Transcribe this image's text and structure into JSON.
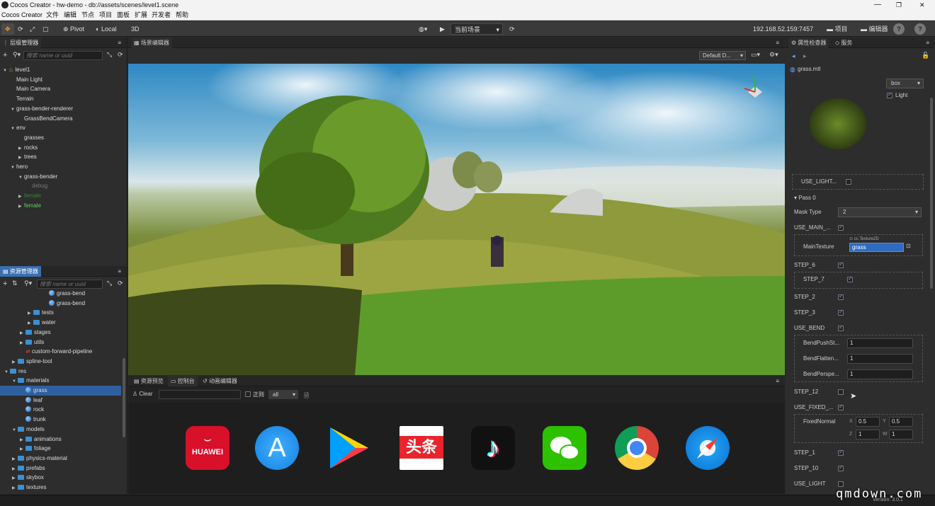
{
  "window": {
    "title": "Cocos Creator - hw-demo - db://assets/scenes/level1.scene",
    "controls": [
      "—",
      "❐",
      "✕"
    ]
  },
  "menu": [
    "Cocos Creator",
    "文件",
    "编辑",
    "节点",
    "项目",
    "面板",
    "扩展",
    "开发者",
    "帮助"
  ],
  "toolbar": {
    "pivot": "Pivot",
    "local": "Local",
    "mode3d": "3D",
    "scene_select": "当前场景",
    "ip": "192.168.52.159:7457",
    "project": "项目",
    "editor": "编辑器",
    "help": "?"
  },
  "hierarchy": {
    "title": "层级管理器",
    "search_placeholder": "搜索 name or uuid",
    "nodes": [
      {
        "label": "level1",
        "depth": 0,
        "arrow": "▼",
        "color": "#ddd"
      },
      {
        "label": "Main Light",
        "depth": 1,
        "arrow": "",
        "color": "#ddd"
      },
      {
        "label": "Main Camera",
        "depth": 1,
        "arrow": "",
        "color": "#ddd"
      },
      {
        "label": "Terrain",
        "depth": 1,
        "arrow": "",
        "color": "#ddd"
      },
      {
        "label": "grass-bender-renderer",
        "depth": 1,
        "arrow": "▼",
        "color": "#ddd"
      },
      {
        "label": "GrassBendCamera",
        "depth": 2,
        "arrow": "",
        "color": "#ddd"
      },
      {
        "label": "env",
        "depth": 1,
        "arrow": "▼",
        "color": "#ddd"
      },
      {
        "label": "grasses",
        "depth": 2,
        "arrow": "",
        "color": "#ddd"
      },
      {
        "label": "rocks",
        "depth": 2,
        "arrow": "▶",
        "color": "#ddd"
      },
      {
        "label": "trees",
        "depth": 2,
        "arrow": "▶",
        "color": "#ddd"
      },
      {
        "label": "hero",
        "depth": 1,
        "arrow": "▼",
        "color": "#ddd"
      },
      {
        "label": "grass-bender",
        "depth": 2,
        "arrow": "▼",
        "color": "#ddd"
      },
      {
        "label": "debug",
        "depth": 3,
        "arrow": "",
        "color": "#777"
      },
      {
        "label": "female",
        "depth": 2,
        "arrow": "▶",
        "color": "#2e8b2e"
      },
      {
        "label": "female",
        "depth": 2,
        "arrow": "▶",
        "color": "#5ad45a"
      }
    ]
  },
  "assets": {
    "title": "资源管理器",
    "search_placeholder": "搜索 name or uuid",
    "items": [
      {
        "label": "grass-bend",
        "depth": 4,
        "icon": "ball",
        "arrow": ""
      },
      {
        "label": "grass-bend",
        "depth": 4,
        "icon": "ball",
        "arrow": ""
      },
      {
        "label": "tests",
        "depth": 2,
        "icon": "folder",
        "arrow": "▶"
      },
      {
        "label": "water",
        "depth": 2,
        "icon": "folder",
        "arrow": "▶"
      },
      {
        "label": "stages",
        "depth": 1,
        "icon": "folder",
        "arrow": "▶"
      },
      {
        "label": "utils",
        "depth": 1,
        "icon": "folder",
        "arrow": "▶"
      },
      {
        "label": "custom-forward-pipeline",
        "depth": 1,
        "icon": "pipe",
        "arrow": ""
      },
      {
        "label": "spline-tool",
        "depth": 0,
        "icon": "folder",
        "arrow": "▶"
      },
      {
        "label": "res",
        "depth": -1,
        "icon": "folder",
        "arrow": "▼"
      },
      {
        "label": "materials",
        "depth": 0,
        "icon": "folder",
        "arrow": "▼"
      },
      {
        "label": "grass",
        "depth": 1,
        "icon": "ball",
        "arrow": "",
        "selected": true
      },
      {
        "label": "leaf",
        "depth": 1,
        "icon": "ball",
        "arrow": ""
      },
      {
        "label": "rock",
        "depth": 1,
        "icon": "ball",
        "arrow": ""
      },
      {
        "label": "trunk",
        "depth": 1,
        "icon": "ball",
        "arrow": ""
      },
      {
        "label": "models",
        "depth": 0,
        "icon": "folder",
        "arrow": "▼"
      },
      {
        "label": "animations",
        "depth": 1,
        "icon": "folder",
        "arrow": "▶"
      },
      {
        "label": "foliage",
        "depth": 1,
        "icon": "folder",
        "arrow": "▶"
      },
      {
        "label": "physics-material",
        "depth": 0,
        "icon": "folder",
        "arrow": "▶"
      },
      {
        "label": "prefabs",
        "depth": 0,
        "icon": "folder",
        "arrow": "▶"
      },
      {
        "label": "skybox",
        "depth": 0,
        "icon": "folder",
        "arrow": "▶"
      },
      {
        "label": "textures",
        "depth": 0,
        "icon": "folder",
        "arrow": "▶"
      }
    ]
  },
  "scene": {
    "title": "场景编辑器",
    "camera_select": "Default D...",
    "gizmo": "3D"
  },
  "console": {
    "tabs": [
      "资源预览",
      "控制台",
      "动画编辑器"
    ],
    "clear": "Clear",
    "regex_label": "正则",
    "filter": "all"
  },
  "watermark_apps": [
    "HUAWEI",
    "App Store",
    "Google Play",
    "头条",
    "TikTok",
    "WeChat",
    "Chrome",
    "Safari"
  ],
  "inspector": {
    "tabs": [
      "属性检查器",
      "服务"
    ],
    "asset": "grass.mtl",
    "preview_shape": "box",
    "light_label": "Light",
    "use_light_label": "USE_LIGHT...",
    "pass_label": "Pass 0",
    "mask_type_label": "Mask Type",
    "mask_type_value": "2",
    "use_main_label": "USE_MAIN_...",
    "main_texture_label": "MainTexture",
    "main_texture_type": "cc.Texture2D",
    "main_texture_value": "grass",
    "step6": "STEP_6",
    "step7": "STEP_7",
    "step2": "STEP_2",
    "step3": "STEP_3",
    "use_bend": "USE_BEND",
    "bend_push": "BendPushSt...",
    "bend_push_val": "1",
    "bend_flatten": "BendFlatten...",
    "bend_flatten_val": "1",
    "bend_persp": "BendPerspe...",
    "bend_persp_val": "1",
    "step12": "STEP_12",
    "use_fixed": "USE_FIXED_...",
    "fixed_normal": "FixedNormal",
    "fx": "0.5",
    "fy": "0.5",
    "fz": "1",
    "fw": "1",
    "step1": "STEP_1",
    "step10": "STEP_10",
    "use_light": "USE_LIGHT"
  },
  "status": {
    "version": "Version: 3.0.1"
  },
  "site_watermark": "qmdown.com"
}
